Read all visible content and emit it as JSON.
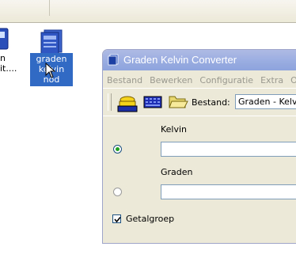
{
  "desktop": {
    "icons": [
      {
        "label_line1": "n",
        "label_line2": "it...."
      },
      {
        "label_line1": "graden",
        "label_line2": "kelvin nod"
      }
    ]
  },
  "window": {
    "title": "Graden Kelvin Converter",
    "menu": [
      "Bestand",
      "Bewerken",
      "Configuratie",
      "Extra",
      "Over"
    ],
    "toolbar": {
      "buttons": [
        "save-icon",
        "keyboard-icon",
        "open-folder-icon"
      ],
      "label": "Bestand:",
      "combo_value": "Graden - Kelvin"
    },
    "fields": [
      {
        "label": "Kelvin",
        "selected": true,
        "value": ""
      },
      {
        "label": "Graden",
        "selected": false,
        "value": ""
      }
    ],
    "checkbox": {
      "label": "Getalgroep",
      "checked": true
    }
  },
  "colors": {
    "titlebar": "#9caee2",
    "selection": "#316ac5",
    "window_bg": "#ece9d8"
  }
}
